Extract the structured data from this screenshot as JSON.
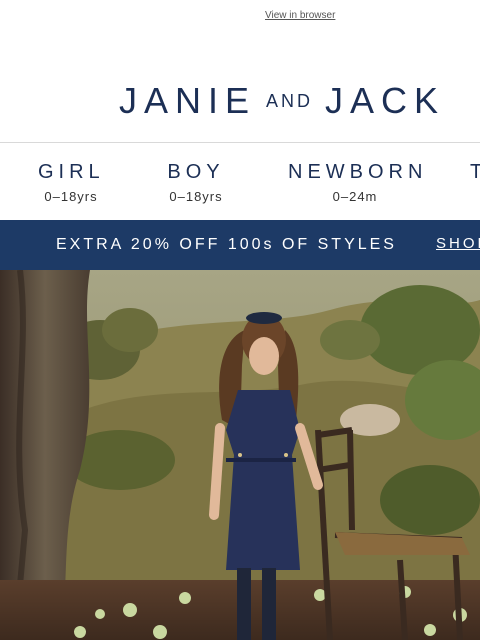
{
  "preheader": {
    "view_in_browser": "View in browser"
  },
  "logo": {
    "part1": "JANIE",
    "part2": "AND",
    "part3": "JACK"
  },
  "nav": [
    {
      "title": "GIRL",
      "sub": "0–18yrs"
    },
    {
      "title": "BOY",
      "sub": "0–18yrs"
    },
    {
      "title": "NEWBORN",
      "sub": "0–24m"
    },
    {
      "title": "T",
      "sub": ""
    }
  ],
  "banner": {
    "text": "EXTRA 20% OFF 100s OF STYLES",
    "link": "SHOP"
  },
  "colors": {
    "brand_navy": "#1c2f55",
    "banner_bg": "#1d3a66"
  },
  "hero": {
    "image": "girl-in-navy-tweed-dress-beside-wooden-chair"
  }
}
